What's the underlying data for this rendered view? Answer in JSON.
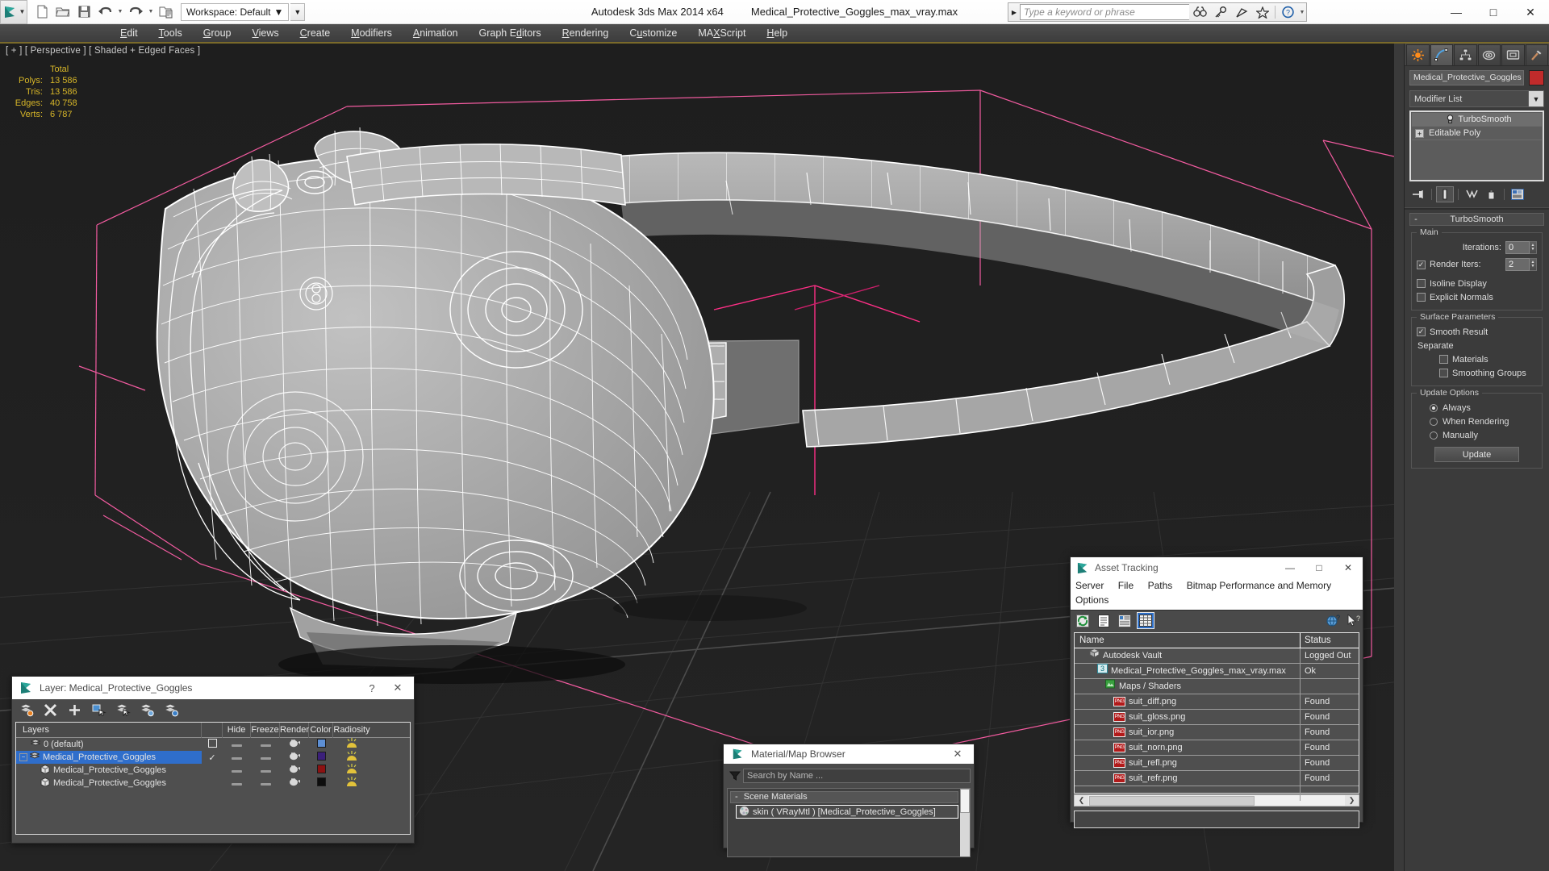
{
  "titlebar": {
    "app_title": "Autodesk 3ds Max  2014 x64",
    "file_title": "Medical_Protective_Goggles_max_vray.max",
    "workspace": "Workspace: Default",
    "search_placeholder": "Type a keyword or phrase",
    "quick_access": [
      {
        "name": "new-file-icon",
        "label": "New"
      },
      {
        "name": "open-file-icon",
        "label": "Open"
      },
      {
        "name": "save-file-icon",
        "label": "Save"
      },
      {
        "name": "undo-icon",
        "label": "Undo"
      },
      {
        "name": "redo-icon",
        "label": "Redo"
      },
      {
        "name": "set-project-folder-icon",
        "label": "Set Project Folder"
      }
    ],
    "help_icons": [
      {
        "name": "search-binoculars-icon",
        "label": "Search"
      },
      {
        "name": "key-icon",
        "label": "Keyword"
      },
      {
        "name": "satellite-dish-icon",
        "label": "Communication Center"
      },
      {
        "name": "favorites-star-icon",
        "label": "Favorites"
      },
      {
        "name": "help-question-icon",
        "label": "Help"
      }
    ],
    "window_buttons": [
      {
        "name": "minimize-button",
        "glyph": "—"
      },
      {
        "name": "maximize-button",
        "glyph": "□"
      },
      {
        "name": "close-button",
        "glyph": "✕"
      }
    ]
  },
  "menubar": {
    "items": [
      {
        "label": "Edit",
        "accel": "E"
      },
      {
        "label": "Tools",
        "accel": "T"
      },
      {
        "label": "Group",
        "accel": "G"
      },
      {
        "label": "Views",
        "accel": "V"
      },
      {
        "label": "Create",
        "accel": "C"
      },
      {
        "label": "Modifiers",
        "accel": "M"
      },
      {
        "label": "Animation",
        "accel": "A"
      },
      {
        "label": "Graph Editors",
        "accel": "d"
      },
      {
        "label": "Rendering",
        "accel": "R"
      },
      {
        "label": "Customize",
        "accel": "u"
      },
      {
        "label": "MAXScript",
        "accel": "X"
      },
      {
        "label": "Help",
        "accel": "H"
      }
    ]
  },
  "viewport": {
    "label": "[ + ] [ Perspective ] [ Shaded + Edged Faces ]",
    "stats": {
      "header": "Total",
      "rows": [
        {
          "label": "Polys:",
          "value": "13 586"
        },
        {
          "label": "Tris:",
          "value": "13 586"
        },
        {
          "label": "Edges:",
          "value": "40 758"
        },
        {
          "label": "Verts:",
          "value": "6 787"
        }
      ]
    },
    "background_color": "#1e1e1e",
    "grid_color": "#3a3a3a",
    "selection_bracket_color": "#ff5fa8",
    "mesh_wire_color": "#ffffff",
    "mesh_fill_color": "#a3a3a3"
  },
  "command_panel": {
    "tabs": [
      {
        "name": "tab-create",
        "icon": "create-icon",
        "active": false
      },
      {
        "name": "tab-modify",
        "icon": "modify-icon",
        "active": true
      },
      {
        "name": "tab-hierarchy",
        "icon": "hierarchy-icon",
        "active": false
      },
      {
        "name": "tab-motion",
        "icon": "motion-icon",
        "active": false
      },
      {
        "name": "tab-display",
        "icon": "display-icon",
        "active": false
      },
      {
        "name": "tab-utilities",
        "icon": "utilities-hammer-icon",
        "active": false
      }
    ],
    "object_name": "Medical_Protective_Goggles",
    "object_color": "#c02b2b",
    "modifier_list_label": "Modifier List",
    "stack": [
      {
        "label": "TurboSmooth",
        "selected": true,
        "icon": "lightbulb-icon"
      },
      {
        "label": "Editable Poly",
        "selected": false,
        "icon": "plus-expand-icon"
      }
    ],
    "stack_tools": [
      {
        "name": "pin-stack-button",
        "icon": "pin-icon"
      },
      {
        "name": "show-end-result-button",
        "icon": "show-end-result-icon",
        "active": true
      },
      {
        "name": "make-unique-button",
        "icon": "make-unique-icon"
      },
      {
        "name": "remove-modifier-button",
        "icon": "trash-icon"
      },
      {
        "name": "configure-modifier-sets-button",
        "icon": "configure-sets-icon"
      }
    ],
    "rollout": {
      "title": "TurboSmooth",
      "collapse_glyph": "-",
      "groups": {
        "main": {
          "title": "Main",
          "iterations_label": "Iterations:",
          "iterations_value": "0",
          "render_iters_label": "Render Iters:",
          "render_iters_value": "2",
          "render_iters_checked": true,
          "isoline_display_label": "Isoline Display",
          "isoline_display_checked": false,
          "explicit_normals_label": "Explicit Normals",
          "explicit_normals_checked": false
        },
        "surface": {
          "title": "Surface Parameters",
          "smooth_result_label": "Smooth Result",
          "smooth_result_checked": true,
          "separate_label": "Separate",
          "materials_label": "Materials",
          "materials_checked": false,
          "smoothing_groups_label": "Smoothing Groups",
          "smoothing_groups_checked": false
        },
        "update": {
          "title": "Update Options",
          "options": [
            {
              "label": "Always",
              "selected": true
            },
            {
              "label": "When Rendering",
              "selected": false
            },
            {
              "label": "Manually",
              "selected": false
            }
          ],
          "update_button": "Update"
        }
      }
    }
  },
  "layer_dialog": {
    "title": "Layer: Medical_Protective_Goggles",
    "help_glyph": "?",
    "close_glyph": "✕",
    "toolbar": [
      {
        "name": "create-new-layer-button",
        "icon": "new-layer-icon"
      },
      {
        "name": "delete-highlighted-layer-button",
        "icon": "delete-x-icon"
      },
      {
        "name": "add-selected-objects-button",
        "icon": "plus-icon"
      },
      {
        "name": "select-objects-in-layer-button",
        "icon": "select-objects-icon"
      },
      {
        "name": "select-highlighted-layers-button",
        "icon": "select-layers-icon"
      },
      {
        "name": "highlight-selected-objects-layers-button",
        "icon": "highlight-layer-icon"
      },
      {
        "name": "hide-unhide-layers-button",
        "icon": "layers-gear-icon"
      }
    ],
    "columns": [
      "Layers",
      "",
      "Hide",
      "Freeze",
      "Render",
      "Color",
      "Radiosity"
    ],
    "rows": [
      {
        "name": "0 (default)",
        "indent": 0,
        "icon": "layer-icon",
        "current": false,
        "expandable": false,
        "color": "#5d8fd4",
        "checkbox": "empty"
      },
      {
        "name": "Medical_Protective_Goggles",
        "indent": 0,
        "icon": "layer-icon",
        "current": true,
        "expandable": true,
        "color": "#3b1f7a",
        "checkbox": "check"
      },
      {
        "name": "Medical_Protective_Goggles",
        "indent": 1,
        "icon": "object-box-icon",
        "current": false,
        "expandable": false,
        "color": "#8c1212",
        "checkbox": "none"
      },
      {
        "name": "Medical_Protective_Goggles",
        "indent": 1,
        "icon": "object-box-icon",
        "current": false,
        "expandable": false,
        "color": "#0d0d0d",
        "checkbox": "none"
      }
    ]
  },
  "material_browser": {
    "title": "Material/Map Browser",
    "close_glyph": "✕",
    "search_placeholder": "Search by Name ...",
    "group_label": "Scene Materials",
    "group_collapse": "-",
    "items": [
      {
        "label": "skin ( VRayMtl ) [Medical_Protective_Goggles]",
        "selected": true,
        "icon": "material-sphere-icon"
      }
    ]
  },
  "asset_tracking": {
    "title": "Asset Tracking",
    "window_buttons": [
      {
        "name": "minimize-button",
        "glyph": "—"
      },
      {
        "name": "maximize-button",
        "glyph": "□"
      },
      {
        "name": "close-button",
        "glyph": "✕"
      }
    ],
    "menus": [
      "Server",
      "File",
      "Paths",
      "Bitmap Performance and Memory",
      "Options"
    ],
    "toolbar": [
      {
        "name": "refresh-button",
        "icon": "refresh-icon",
        "active": false
      },
      {
        "name": "list-view-button",
        "icon": "list-view-icon",
        "active": false
      },
      {
        "name": "detail-view-button",
        "icon": "detail-view-icon",
        "active": false
      },
      {
        "name": "grid-view-button",
        "icon": "grid-view-icon",
        "active": true
      },
      {
        "name": "help-button",
        "icon": "help-globe-icon",
        "active": false
      },
      {
        "name": "what-is-this-button",
        "icon": "help-arrow-icon",
        "active": false
      }
    ],
    "columns": [
      "Name",
      "Status"
    ],
    "rows": [
      {
        "name": "Autodesk Vault",
        "status": "Logged Out",
        "indent": 1,
        "icon": "vault-icon"
      },
      {
        "name": "Medical_Protective_Goggles_max_vray.max",
        "status": "Ok",
        "indent": 2,
        "icon": "max-file-icon"
      },
      {
        "name": "Maps / Shaders",
        "status": "",
        "indent": 3,
        "icon": "maps-shaders-icon"
      },
      {
        "name": "suit_diff.png",
        "status": "Found",
        "indent": 4,
        "icon": "png-icon"
      },
      {
        "name": "suit_gloss.png",
        "status": "Found",
        "indent": 4,
        "icon": "png-icon"
      },
      {
        "name": "suit_ior.png",
        "status": "Found",
        "indent": 4,
        "icon": "png-icon"
      },
      {
        "name": "suit_norn.png",
        "status": "Found",
        "indent": 4,
        "icon": "png-icon"
      },
      {
        "name": "suit_refl.png",
        "status": "Found",
        "indent": 4,
        "icon": "png-icon"
      },
      {
        "name": "suit_refr.png",
        "status": "Found",
        "indent": 4,
        "icon": "png-icon"
      }
    ],
    "scroll_left_glyph": "❮",
    "scroll_right_glyph": "❯"
  }
}
